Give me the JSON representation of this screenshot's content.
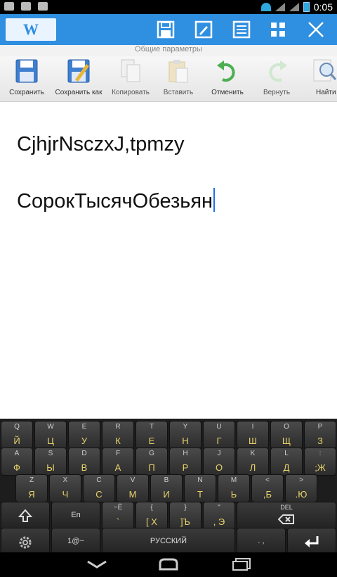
{
  "status_bar": {
    "time": "0:05"
  },
  "toolbar": {
    "logo_text": "W",
    "icons": [
      "save-icon",
      "edit-icon",
      "list-icon",
      "grid-icon",
      "close-icon"
    ]
  },
  "ribbon": {
    "title": "Общие параметры",
    "items": [
      {
        "label": "Сохранить",
        "icon": "save-icon"
      },
      {
        "label": "Сохранить как",
        "icon": "save-as-icon"
      },
      {
        "label": "Копировать",
        "icon": "copy-icon"
      },
      {
        "label": "Вставить",
        "icon": "paste-icon"
      },
      {
        "label": "Отменить",
        "icon": "undo-icon"
      },
      {
        "label": "Вернуть",
        "icon": "redo-icon"
      },
      {
        "label": "Найти",
        "icon": "search-icon"
      }
    ]
  },
  "document": {
    "line1": "CjhjrNsczxJ,tpmzy",
    "line2": "СорокТысячОбезьян"
  },
  "keyboard": {
    "row1": [
      {
        "lat": "Q",
        "cyr": "Й"
      },
      {
        "lat": "W",
        "cyr": "Ц"
      },
      {
        "lat": "E",
        "cyr": "У"
      },
      {
        "lat": "R",
        "cyr": "К"
      },
      {
        "lat": "T",
        "cyr": "Е"
      },
      {
        "lat": "Y",
        "cyr": "Н"
      },
      {
        "lat": "U",
        "cyr": "Г"
      },
      {
        "lat": "I",
        "cyr": "Ш"
      },
      {
        "lat": "O",
        "cyr": "Щ"
      },
      {
        "lat": "P",
        "cyr": "З"
      }
    ],
    "row2": [
      {
        "lat": "A",
        "cyr": "Ф"
      },
      {
        "lat": "S",
        "cyr": "Ы"
      },
      {
        "lat": "D",
        "cyr": "В"
      },
      {
        "lat": "F",
        "cyr": "А"
      },
      {
        "lat": "G",
        "cyr": "П"
      },
      {
        "lat": "H",
        "cyr": "Р"
      },
      {
        "lat": "J",
        "cyr": "О"
      },
      {
        "lat": "K",
        "cyr": "Л"
      },
      {
        "lat": "L",
        "cyr": "Д"
      },
      {
        "lat": ":",
        "cyr": ";Ж"
      }
    ],
    "row3": [
      {
        "lat": "Z",
        "cyr": "Я"
      },
      {
        "lat": "X",
        "cyr": "Ч"
      },
      {
        "lat": "C",
        "cyr": "С"
      },
      {
        "lat": "V",
        "cyr": "М"
      },
      {
        "lat": "B",
        "cyr": "И"
      },
      {
        "lat": "N",
        "cyr": "Т"
      },
      {
        "lat": "M",
        "cyr": "Ь"
      },
      {
        "lat": "<",
        "cyr": ",Б"
      },
      {
        "lat": ">",
        "cyr": ".Ю"
      }
    ],
    "row4": {
      "shift_icon": "shift-icon",
      "lang": "En",
      "k1": {
        "lat": "~Ё",
        "cyr": "`"
      },
      "k2": {
        "lat": "{",
        "cyr": "[ Х"
      },
      "k3": {
        "lat": "}",
        "cyr": "]Ъ"
      },
      "k4": {
        "lat": "\"",
        "cyr": ", Э"
      },
      "del": "DEL"
    },
    "row5": {
      "settings_icon": "gear-icon",
      "symbols": "1@~",
      "space": "РУССКИЙ",
      "punct": ". ,",
      "enter_icon": "enter-icon"
    }
  },
  "navigation": {
    "icons": [
      "back-icon",
      "home-icon",
      "recent-apps-icon"
    ]
  }
}
